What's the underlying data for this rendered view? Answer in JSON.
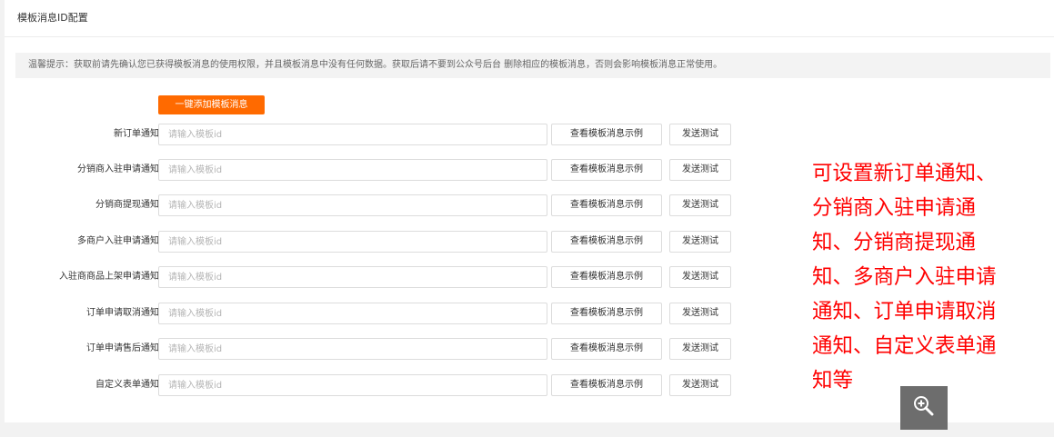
{
  "panel": {
    "title": "模板消息ID配置"
  },
  "notice": "温馨提示：获取前请先确认您已获得模板消息的使用权限，并且模板消息中没有任何数据。获取后请不要到公众号后台 删除相应的模板消息，否则会影响模板消息正常使用。",
  "add_button": "一键添加模板消息",
  "placeholder": "请输入模板id",
  "example_label": "查看模板消息示例",
  "test_label": "发送测试",
  "rows": [
    {
      "label": "新订单通知"
    },
    {
      "label": "分销商入驻申请通知"
    },
    {
      "label": "分销商提现通知"
    },
    {
      "label": "多商户入驻申请通知"
    },
    {
      "label": "入驻商商品上架申请通知"
    },
    {
      "label": "订单申请取消通知"
    },
    {
      "label": "订单申请售后通知"
    },
    {
      "label": "自定义表单通知"
    }
  ],
  "annotation": "可设置新订单通知、\n分销商入驻申请通\n知、分销商提现通\n知、多商户入驻申请\n通知、订单申请取消\n通知、自定义表单通\n知等",
  "zoom_icon": "zoom-in-icon",
  "colors": {
    "accent": "#ff6a00",
    "annotation": "#ff0000"
  }
}
